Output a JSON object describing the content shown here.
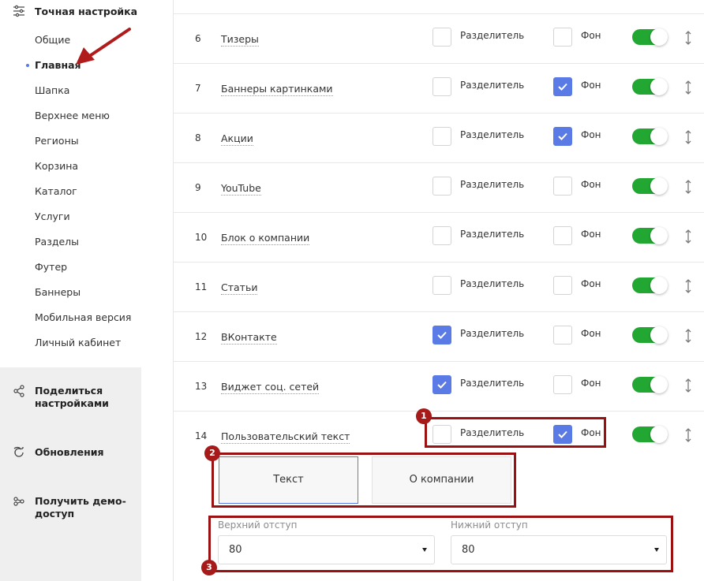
{
  "sidebar": {
    "heading": "Точная настройка",
    "items": [
      {
        "label": "Общие",
        "active": false
      },
      {
        "label": "Главная",
        "active": true
      },
      {
        "label": "Шапка",
        "active": false
      },
      {
        "label": "Верхнее меню",
        "active": false
      },
      {
        "label": "Регионы",
        "active": false
      },
      {
        "label": "Корзина",
        "active": false
      },
      {
        "label": "Каталог",
        "active": false
      },
      {
        "label": "Услуги",
        "active": false
      },
      {
        "label": "Разделы",
        "active": false
      },
      {
        "label": "Футер",
        "active": false
      },
      {
        "label": "Баннеры",
        "active": false
      },
      {
        "label": "Мобильная версия",
        "active": false
      },
      {
        "label": "Личный кабинет",
        "active": false
      }
    ],
    "share_label": "Поделиться настройками",
    "updates_label": "Обновления",
    "demo_label": "Получить демо-доступ"
  },
  "labels": {
    "separator": "Разделитель",
    "background": "Фон"
  },
  "rows": [
    {
      "num": "6",
      "name": "Тизеры",
      "separator": false,
      "background": false,
      "enabled": true
    },
    {
      "num": "7",
      "name": "Баннеры картинками",
      "separator": false,
      "background": true,
      "enabled": true
    },
    {
      "num": "8",
      "name": "Акции",
      "separator": false,
      "background": true,
      "enabled": true
    },
    {
      "num": "9",
      "name": "YouTube",
      "separator": false,
      "background": false,
      "enabled": true
    },
    {
      "num": "10",
      "name": "Блок о компании",
      "separator": false,
      "background": false,
      "enabled": true
    },
    {
      "num": "11",
      "name": "Статьи",
      "separator": false,
      "background": false,
      "enabled": true
    },
    {
      "num": "12",
      "name": "ВКонтакте",
      "separator": true,
      "background": false,
      "enabled": true
    },
    {
      "num": "13",
      "name": "Виджет соц. сетей",
      "separator": true,
      "background": false,
      "enabled": true
    },
    {
      "num": "14",
      "name": "Пользовательский текст",
      "separator": false,
      "background": true,
      "enabled": true
    }
  ],
  "tabs": [
    {
      "label": "Текст",
      "selected": true
    },
    {
      "label": "О компании",
      "selected": false
    }
  ],
  "fields": {
    "top_label": "Верхний отступ",
    "top_value": "80",
    "bottom_label": "Нижний отступ",
    "bottom_value": "80"
  },
  "callouts": [
    "1",
    "2",
    "3"
  ],
  "colors": {
    "accent": "#5a7be6",
    "toggle_on": "#22a832",
    "callout": "#9b1111",
    "arrow": "#b01c1c"
  }
}
